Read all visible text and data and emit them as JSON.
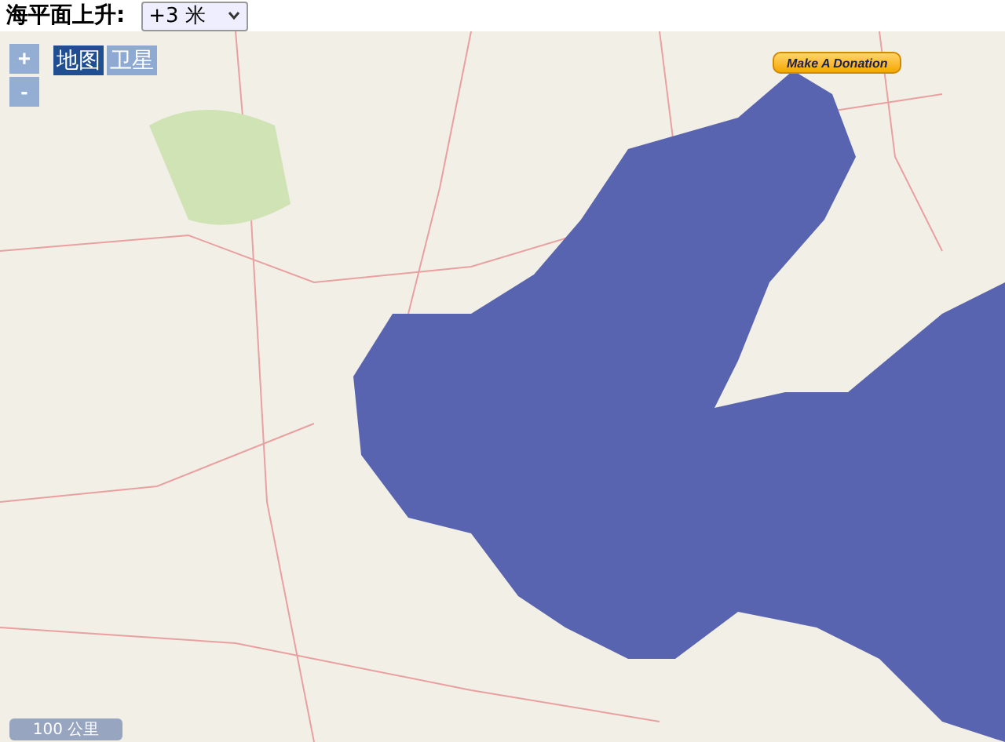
{
  "header": {
    "label": "海平面上升:",
    "select": {
      "value": "+3 米"
    }
  },
  "zoom_controls": [
    {
      "label": "+"
    },
    {
      "label": "-"
    }
  ],
  "map_types": [
    {
      "label": "地图",
      "selected": true
    },
    {
      "label": "卫星",
      "selected": false
    }
  ],
  "donate_button": {
    "label": "Make A Donation"
  },
  "scale": {
    "label": "100 公里"
  }
}
